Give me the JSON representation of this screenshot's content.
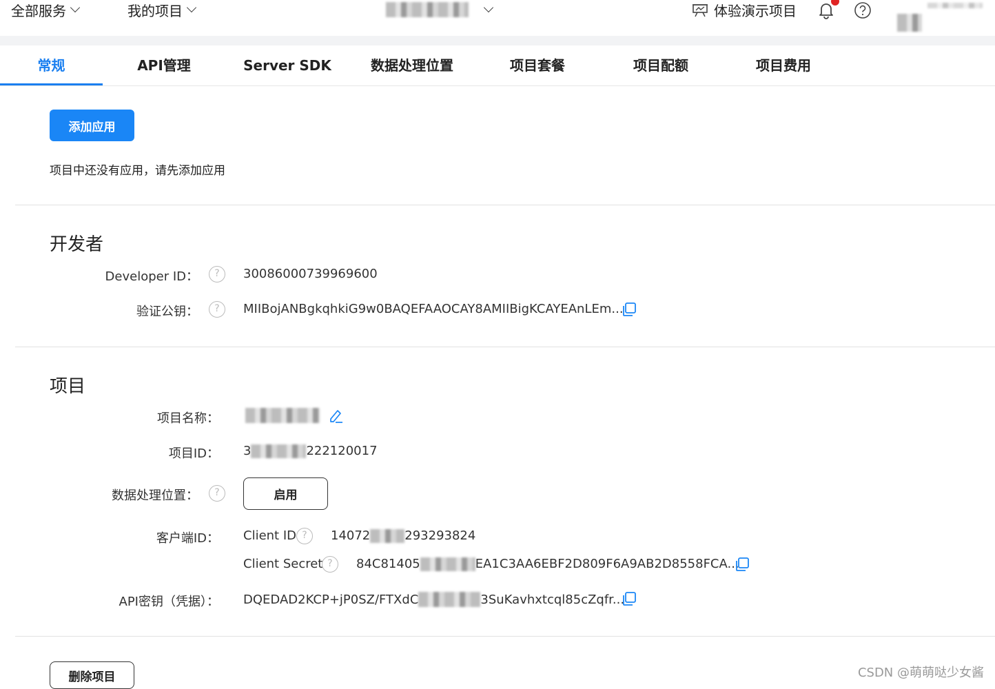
{
  "topbar": {
    "all_services": "全部服务",
    "my_projects": "我的项目",
    "demo_project": "体验演示项目"
  },
  "tabs": [
    {
      "label": "常规"
    },
    {
      "label": "API管理"
    },
    {
      "label": "Server SDK"
    },
    {
      "label": "数据处理位置"
    },
    {
      "label": "项目套餐"
    },
    {
      "label": "项目配额"
    },
    {
      "label": "项目费用"
    }
  ],
  "apps": {
    "add_button": "添加应用",
    "empty_hint": "项目中还没有应用，请先添加应用"
  },
  "developer": {
    "title": "开发者",
    "id_label": "Developer ID：",
    "id_value": "30086000739969600",
    "key_label": "验证公钥：",
    "key_value": "MIIBojANBgkqhkiG9w0BAQEFAAOCAY8AMIIBigKCAYEAnLEm..."
  },
  "project": {
    "title": "项目",
    "name_label": "项目名称：",
    "id_label": "项目ID：",
    "id_value_prefix": "3",
    "id_value_suffix": "222120017",
    "location_label": "数据处理位置：",
    "location_button": "启用",
    "client_label": "客户端ID：",
    "client_id_label": "Client ID",
    "client_id_prefix": "14072",
    "client_id_suffix": "293293824",
    "client_secret_label": "Client Secret",
    "client_secret_prefix": "84C81405",
    "client_secret_suffix": "EA1C3AA6EBF2D809F6A9AB2D8558FCA...",
    "api_key_label": "API密钥（凭据）：",
    "api_key_prefix": "DQEDAD2KCP+jP0SZ/FTXdC",
    "api_key_suffix": "3SuKavhxtcql85cZqfr..."
  },
  "footer": {
    "delete_button": "删除项目",
    "watermark": "CSDN @萌萌哒少女酱"
  },
  "colors": {
    "accent": "#1a7ff0",
    "button_primary": "#1a86f6",
    "badge": "#e02424"
  }
}
